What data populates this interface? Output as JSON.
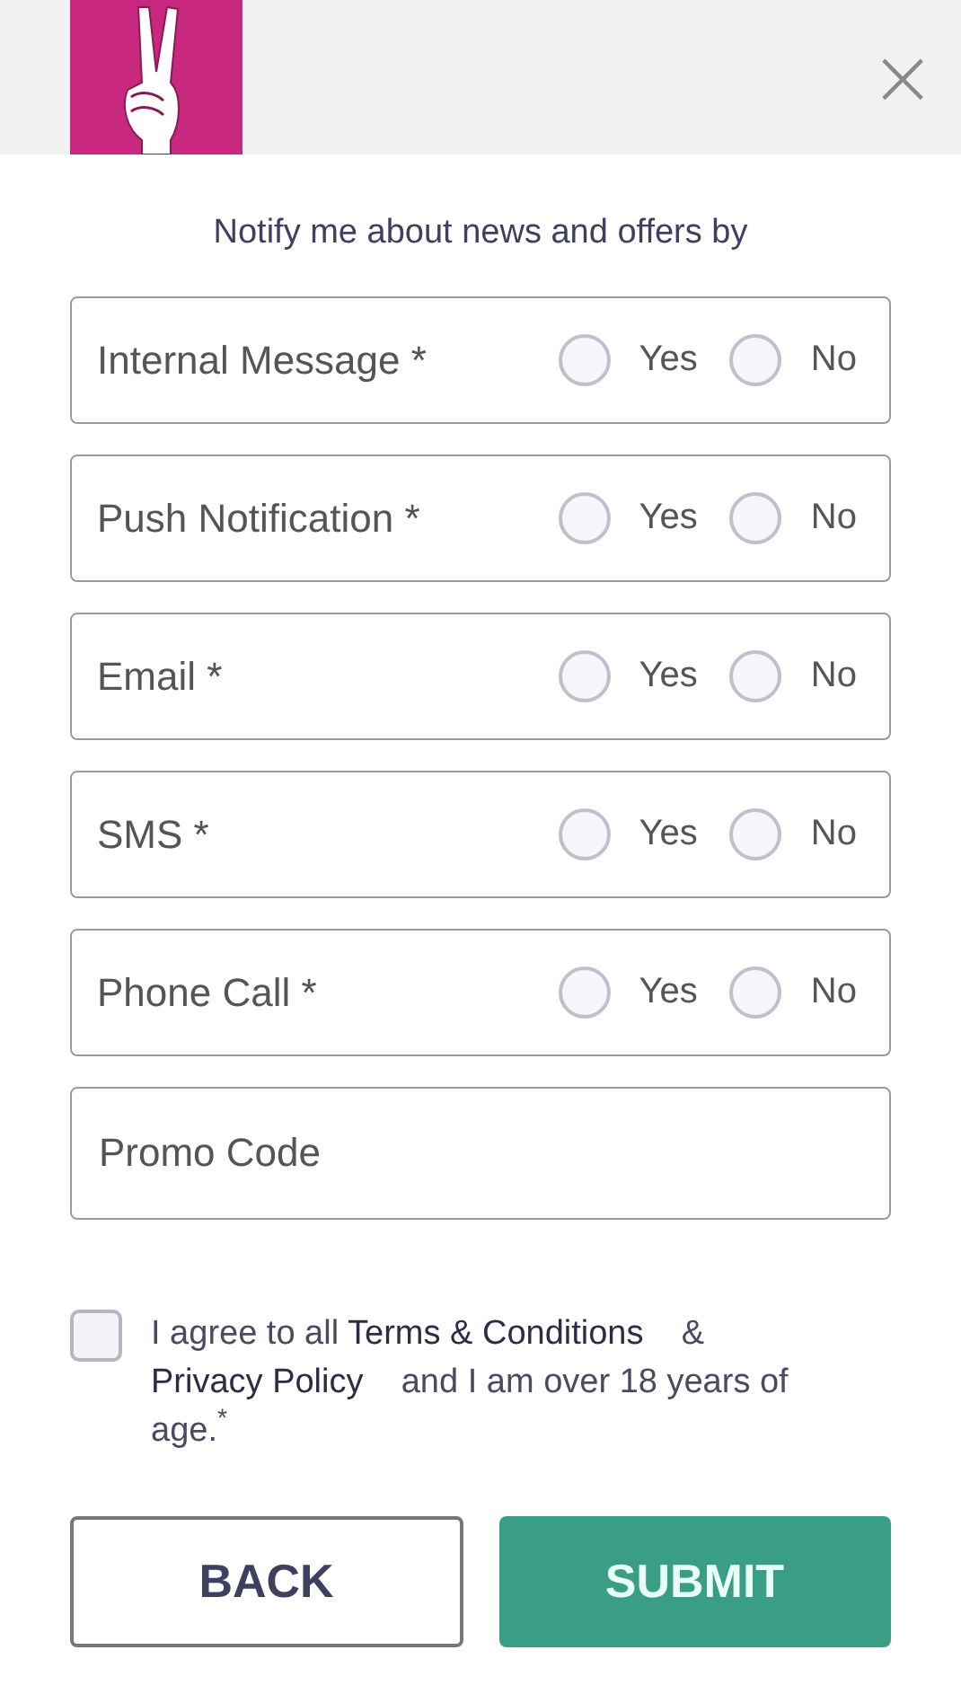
{
  "header": {
    "close": "×"
  },
  "heading": "Notify me about news and offers by",
  "channels": [
    {
      "label": "Internal Message *",
      "options": [
        {
          "label": "Yes",
          "selected": false
        },
        {
          "label": "No",
          "selected": false
        }
      ]
    },
    {
      "label": "Push Notification *",
      "options": [
        {
          "label": "Yes",
          "selected": false
        },
        {
          "label": "No",
          "selected": false
        }
      ]
    },
    {
      "label": "Email *",
      "options": [
        {
          "label": "Yes",
          "selected": false
        },
        {
          "label": "No",
          "selected": false
        }
      ]
    },
    {
      "label": "SMS *",
      "options": [
        {
          "label": "Yes",
          "selected": false
        },
        {
          "label": "No",
          "selected": false
        }
      ]
    },
    {
      "label": "Phone Call *",
      "options": [
        {
          "label": "Yes",
          "selected": false
        },
        {
          "label": "No",
          "selected": false
        }
      ]
    }
  ],
  "promo_code": {
    "placeholder": "Promo Code"
  },
  "agreement": {
    "checked": false,
    "text_before": "I agree to all",
    "terms_link": "Terms & Conditions",
    "middle": "&",
    "privacy_link": "Privacy Policy",
    "text_after": "and I am over 18 years of age.$^{*}$"
  },
  "buttons": [
    {
      "label": "BACK",
      "kind": "secondary"
    },
    {
      "label": "SUBMIT",
      "kind": "primary"
    }
  ]
}
